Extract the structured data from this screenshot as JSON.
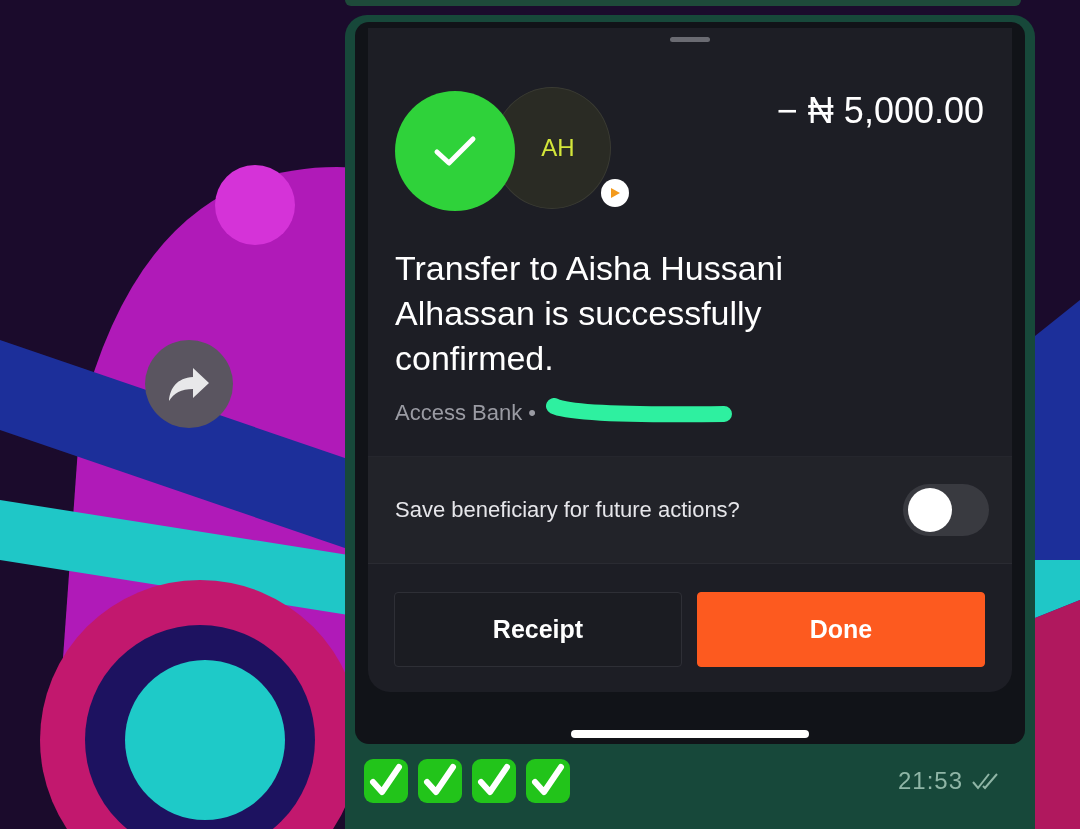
{
  "transfer": {
    "amount": "− ₦ 5,000.00",
    "avatar_initials": "AH",
    "message": "Transfer to Aisha Hussani Alhassan is successfully confirmed.",
    "bank": "Access Bank •"
  },
  "save_beneficiary": {
    "label": "Save beneficiary for future actions?",
    "on": false
  },
  "buttons": [
    {
      "label": "Receipt",
      "kind": "secondary"
    },
    {
      "label": "Done",
      "kind": "primary"
    }
  ],
  "caption": [
    {
      "kind": "check"
    },
    {
      "kind": "check"
    },
    {
      "kind": "check"
    },
    {
      "kind": "check"
    }
  ],
  "time": "21:53",
  "read": true
}
